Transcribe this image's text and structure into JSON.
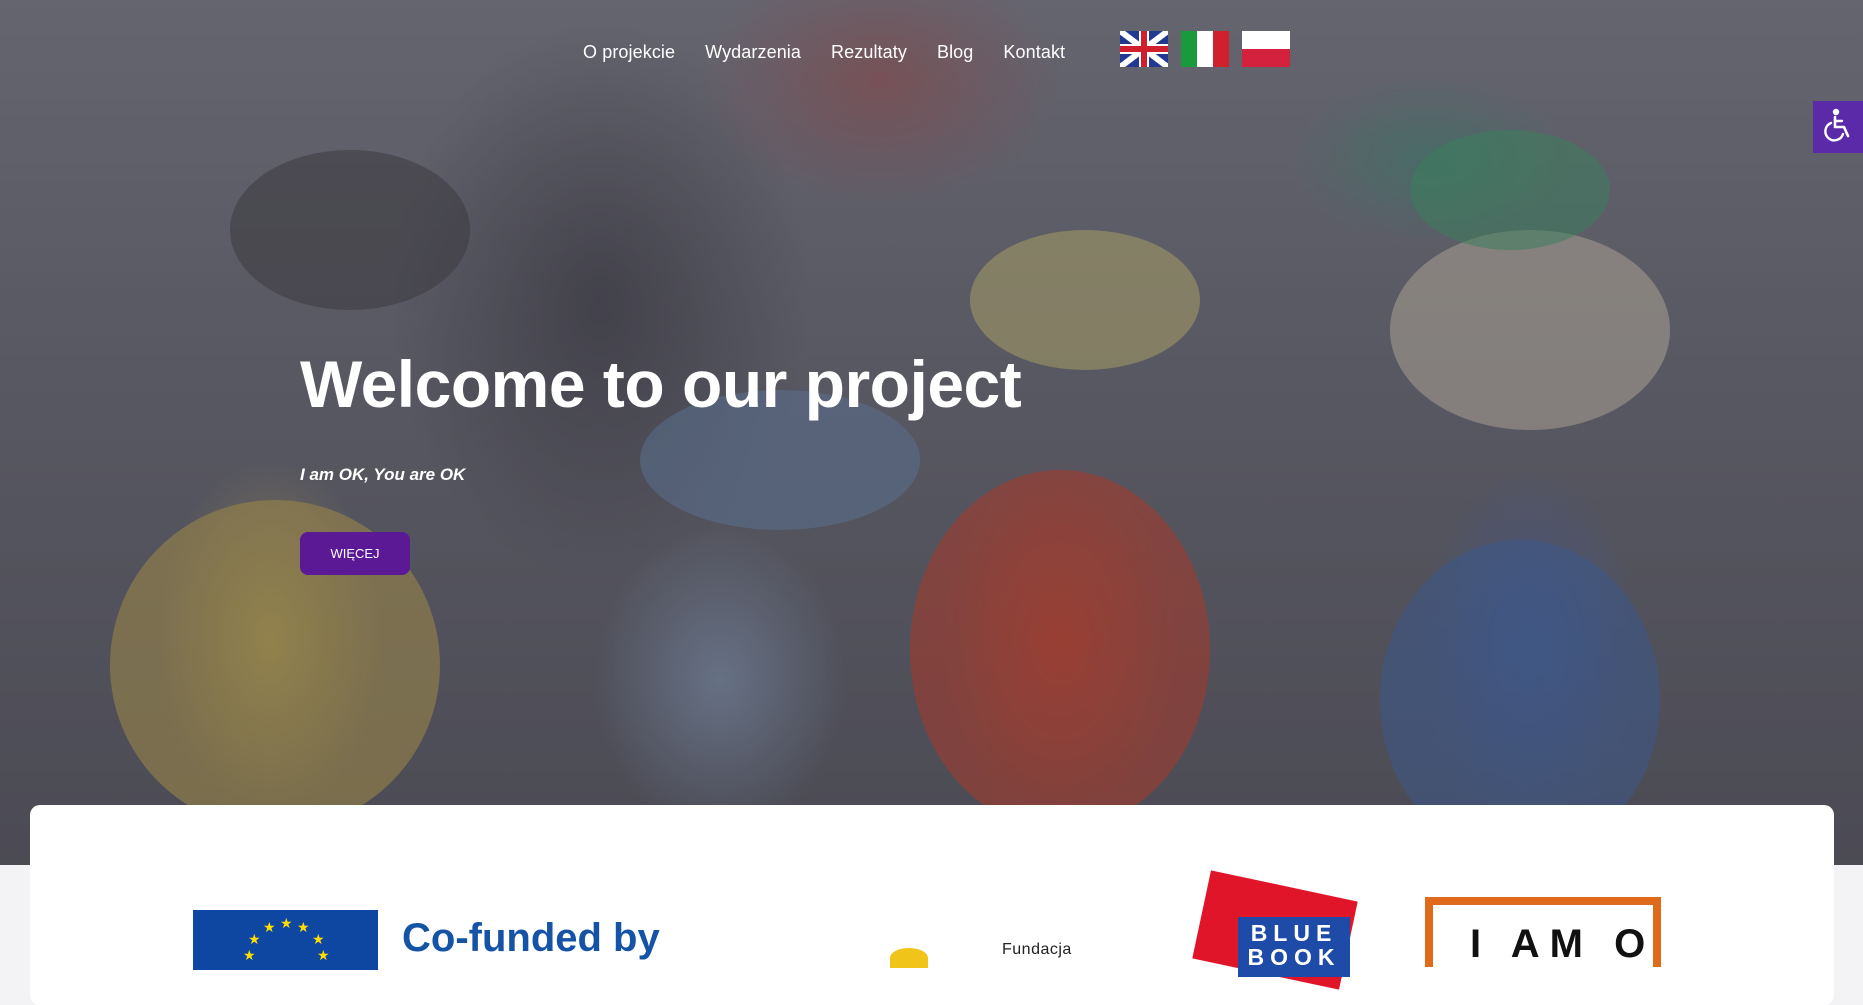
{
  "nav": {
    "items": [
      {
        "label": "O projekcie"
      },
      {
        "label": "Wydarzenia"
      },
      {
        "label": "Rezultaty"
      },
      {
        "label": "Blog"
      },
      {
        "label": "Kontakt"
      }
    ],
    "languages": [
      "en",
      "it",
      "pl"
    ]
  },
  "hero": {
    "title": "Welcome to our project",
    "subtitle": "I am OK, You are OK",
    "button_label": "WIĘCEJ"
  },
  "footer_logos": {
    "eu_text": "Co-funded by",
    "fundacja_text": "Fundacja",
    "blue_book_text": "BLUE BOOK",
    "iamok_text": "I AM O"
  },
  "colors": {
    "accent_purple": "#5b1996",
    "accessibility_purple": "#5b2aa8",
    "eu_blue": "#0e47a1"
  },
  "icons": {
    "accessibility": "wheelchair-icon"
  }
}
